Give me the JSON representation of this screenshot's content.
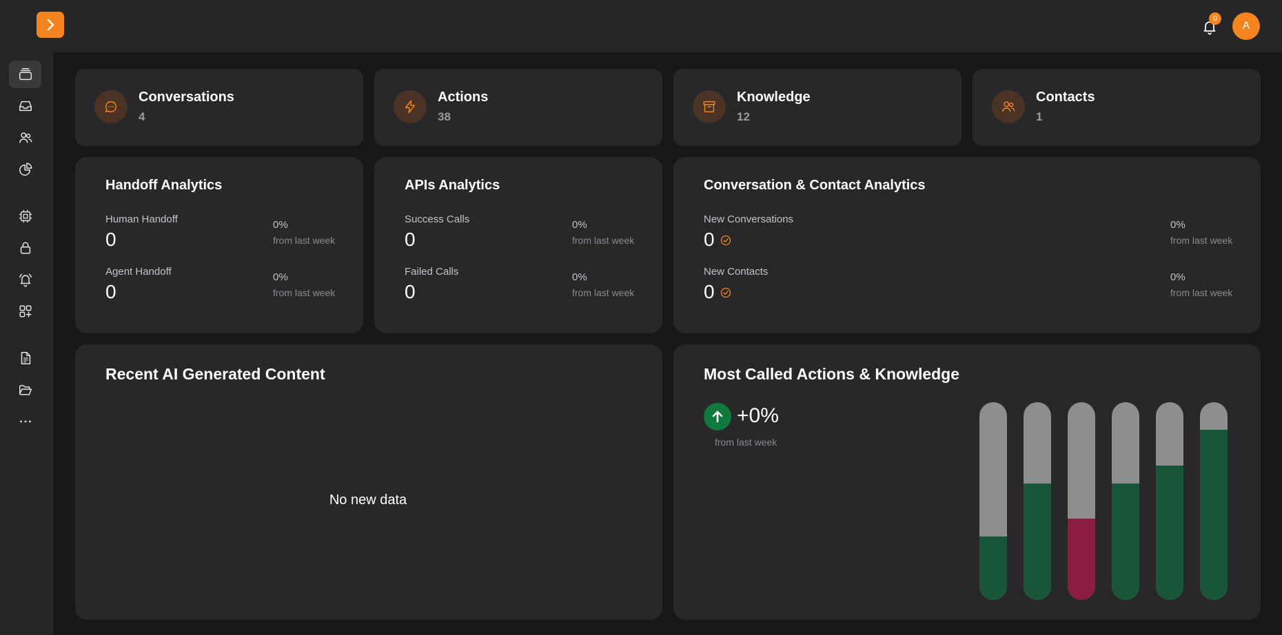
{
  "header": {
    "notification_count": "0",
    "avatar_initial": "A"
  },
  "sidebar": {
    "items": [
      {
        "icon": "layers-icon",
        "active": true
      },
      {
        "icon": "inbox-icon"
      },
      {
        "icon": "users-icon"
      },
      {
        "icon": "pie-chart-icon"
      },
      {
        "icon": "chip-icon"
      },
      {
        "icon": "lock-icon"
      },
      {
        "icon": "alarm-bell-icon"
      },
      {
        "icon": "apps-add-icon"
      },
      {
        "icon": "document-icon"
      },
      {
        "icon": "folder-icon"
      },
      {
        "icon": "more-icon"
      }
    ]
  },
  "stats": [
    {
      "title": "Conversations",
      "value": "4",
      "icon": "chat-bubble-icon"
    },
    {
      "title": "Actions",
      "value": "38",
      "icon": "lightning-icon"
    },
    {
      "title": "Knowledge",
      "value": "12",
      "icon": "archive-icon"
    },
    {
      "title": "Contacts",
      "value": "1",
      "icon": "users-icon"
    }
  ],
  "handoff": {
    "title": "Handoff Analytics",
    "rows": [
      {
        "label": "Human Handoff",
        "value": "0",
        "pct": "0%",
        "sub": "from last week"
      },
      {
        "label": "Agent Handoff",
        "value": "0",
        "pct": "0%",
        "sub": "from last week"
      }
    ]
  },
  "apis": {
    "title": "APIs Analytics",
    "rows": [
      {
        "label": "Success Calls",
        "value": "0",
        "pct": "0%",
        "sub": "from last week"
      },
      {
        "label": "Failed Calls",
        "value": "0",
        "pct": "0%",
        "sub": "from last week"
      }
    ]
  },
  "conv_contact": {
    "title": "Conversation & Contact Analytics",
    "rows": [
      {
        "label": "New Conversations",
        "value": "0",
        "pct": "0%",
        "sub": "from last week"
      },
      {
        "label": "New Contacts",
        "value": "0",
        "pct": "0%",
        "sub": "from last week"
      }
    ]
  },
  "recent": {
    "title": "Recent AI Generated Content",
    "empty_text": "No new data"
  },
  "most_called": {
    "title": "Most Called Actions & Knowledge",
    "trend_value": "+0%",
    "trend_sub": "from last week"
  },
  "colors": {
    "accent": "#f5841f",
    "bar_green": "#185637",
    "bar_red": "#8b1d44",
    "bar_track": "#8e8e91",
    "trend_green": "#0f7a3c"
  },
  "chart_data": {
    "type": "bar",
    "values": [
      0.32,
      0.59,
      0.41,
      0.59,
      0.68,
      0.86
    ],
    "colors": [
      "green",
      "green",
      "red",
      "green",
      "green",
      "green"
    ],
    "ylim": [
      0,
      1
    ]
  }
}
